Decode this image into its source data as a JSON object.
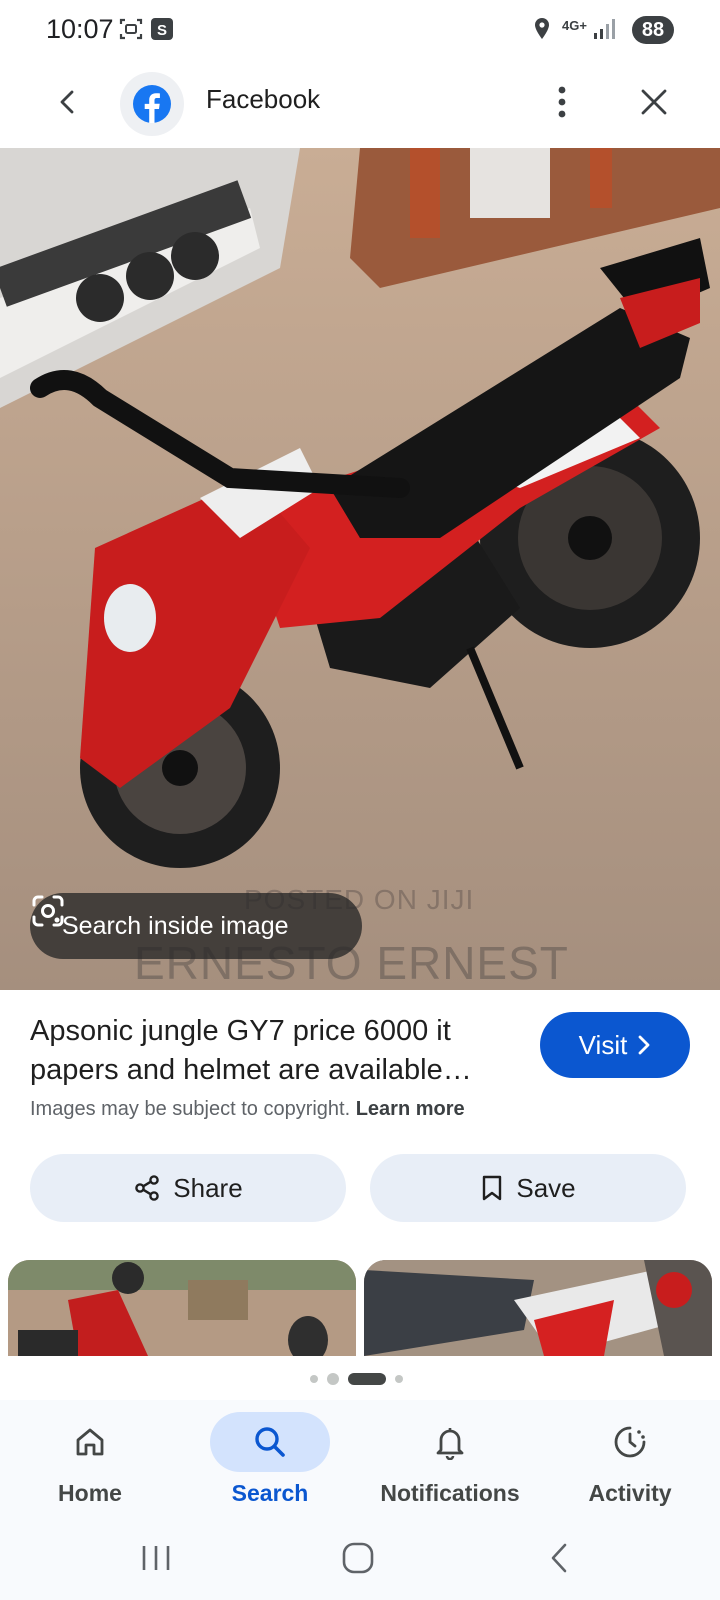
{
  "status": {
    "time": "10:07",
    "network": "4G+",
    "battery": "88"
  },
  "topbar": {
    "site_name": "Facebook"
  },
  "image": {
    "watermark_line1": "POSTED ON JIJI",
    "watermark_line2": "ERNESTO ERNEST",
    "search_inside_label": "Search inside image"
  },
  "result": {
    "title": "Apsonic jungle GY7 price 6000 it papers and helmet are available…",
    "visit_label": "Visit",
    "copyright_text": "Images may be subject to copyright.",
    "learn_more": "Learn more"
  },
  "actions": {
    "share_label": "Share",
    "save_label": "Save"
  },
  "carousel": {
    "pages": 4,
    "active_index": 2
  },
  "bottom_nav": {
    "items": [
      {
        "label": "Home",
        "icon": "home-icon"
      },
      {
        "label": "Search",
        "icon": "search-icon"
      },
      {
        "label": "Notifications",
        "icon": "bell-icon"
      },
      {
        "label": "Activity",
        "icon": "activity-icon"
      }
    ],
    "active": "Search"
  },
  "colors": {
    "accent": "#0b57d0",
    "chip_bg": "#e8eef7",
    "active_pill": "#d3e3fd",
    "facebook_blue": "#1877f2"
  }
}
